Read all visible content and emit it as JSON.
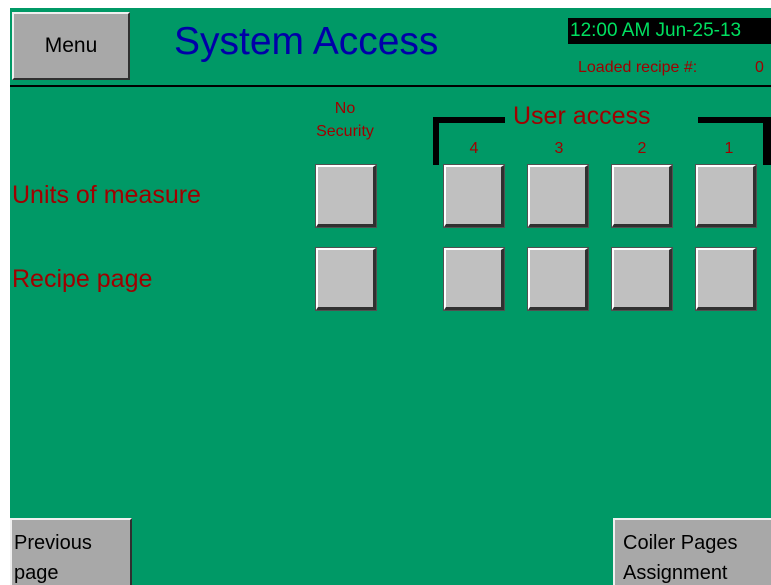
{
  "header": {
    "menu_label": "Menu",
    "title": "System Access",
    "clock": "12:00 AM Jun-25-13",
    "loaded_recipe_label": "Loaded recipe #:",
    "loaded_recipe_value": "0"
  },
  "columns": {
    "no_security_line1": "No",
    "no_security_line2": "Security",
    "user_access_title": "User access",
    "levels": [
      "4",
      "3",
      "2",
      "1"
    ]
  },
  "rows": [
    {
      "label": "Units of measure"
    },
    {
      "label": "Recipe page"
    }
  ],
  "footer": {
    "previous_line1": "Previous",
    "previous_line2": "page",
    "coiler_line1": "Coiler Pages",
    "coiler_line2": "Assignment"
  },
  "colors": {
    "background": "#009966",
    "title": "#0000a8",
    "label": "#a00000",
    "clock_text": "#00e060",
    "button_face": "#a8a8a8"
  }
}
